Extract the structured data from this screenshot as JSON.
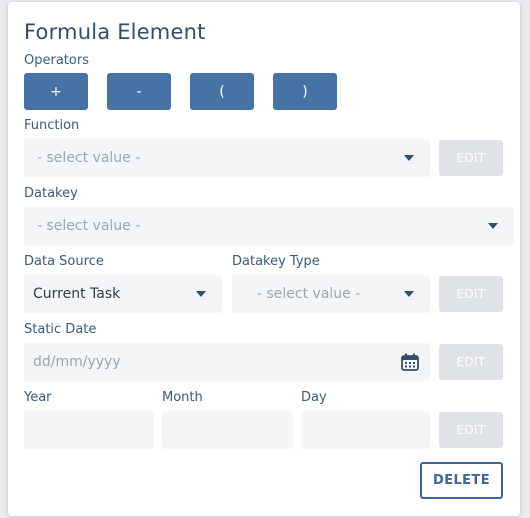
{
  "title": "Formula Element",
  "operators": {
    "label": "Operators",
    "buttons": [
      "+",
      "-",
      "(",
      ")"
    ]
  },
  "function": {
    "label": "Function",
    "placeholder": "- select value -",
    "edit_label": "EDIT"
  },
  "datakey": {
    "label": "Datakey",
    "placeholder": "- select value -"
  },
  "data_source": {
    "label": "Data Source",
    "value": "Current Task"
  },
  "datakey_type": {
    "label": "Datakey Type",
    "placeholder": "- select value -",
    "edit_label": "EDIT"
  },
  "static_date": {
    "label": "Static Date",
    "placeholder": "dd/mm/yyyy",
    "edit_label": "EDIT",
    "icon": "calendar-icon"
  },
  "ymd": {
    "year_label": "Year",
    "month_label": "Month",
    "day_label": "Day",
    "edit_label": "EDIT"
  },
  "delete_label": "DELETE",
  "colors": {
    "primary": "#4772a5",
    "title": "#334e68",
    "field_bg": "#f3f5f7",
    "disabled_btn": "#dfe3e8"
  }
}
